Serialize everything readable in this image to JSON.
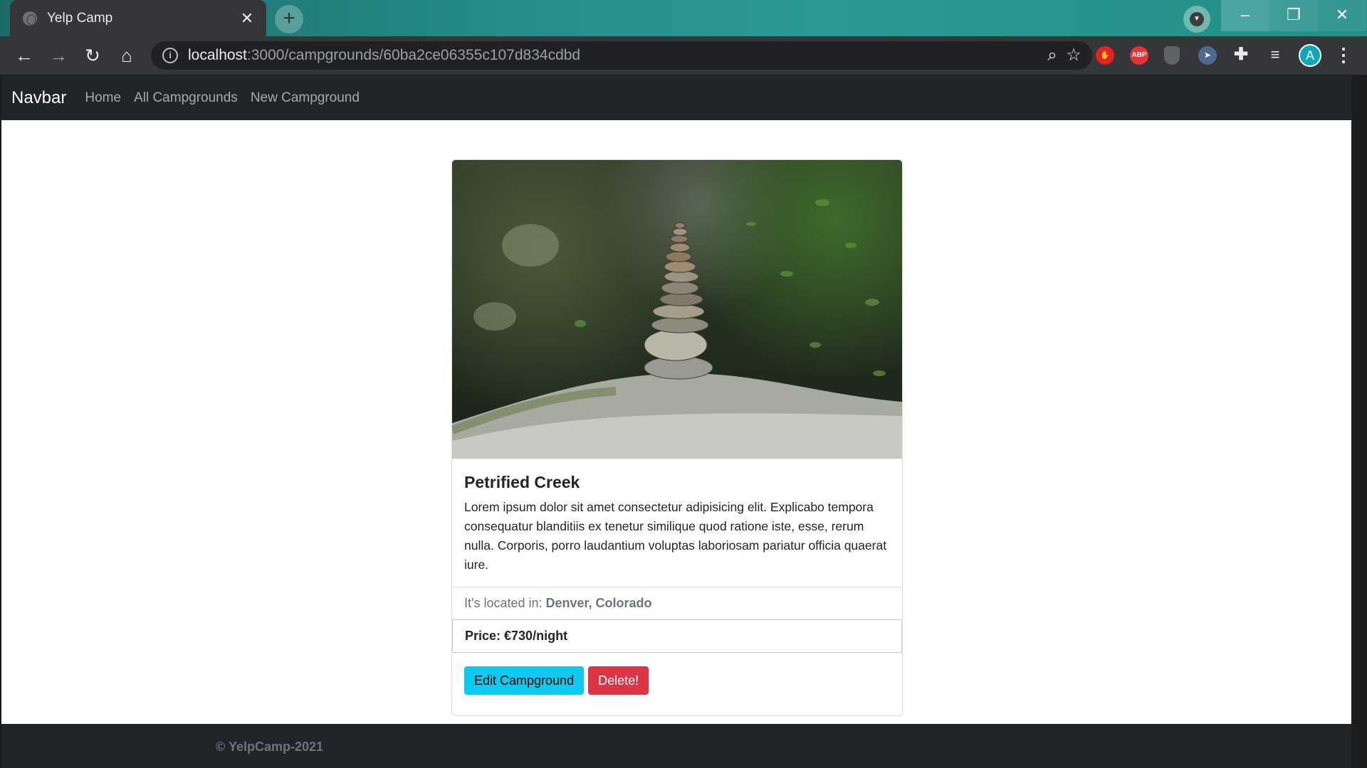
{
  "browser": {
    "tab_title": "Yelp Camp",
    "tab_close": "✕",
    "new_tab": "+",
    "url_host": "localhost",
    "url_path": ":3000/campgrounds/60ba2ce06355c107d834cdbd",
    "extensions": [
      "ABP"
    ],
    "avatar_letter": "A",
    "window_controls": {
      "minimize": "–",
      "maximize": "❐",
      "close": "✕"
    }
  },
  "site_nav": {
    "brand": "Navbar",
    "links": [
      "Home",
      "All Campgrounds",
      "New Campground"
    ]
  },
  "campground": {
    "image_alt": "stacked stones cairn on mossy rock",
    "title": "Petrified Creek",
    "description": "Lorem ipsum dolor sit amet consectetur adipisicing elit. Explicabo tempora consequatur blanditiis ex tenetur similique quod ratione iste, esse, rerum nulla. Corporis, porro laudantium voluptas laboriosam pariatur officia quaerat iure.",
    "location_label": "It's located in:",
    "location": "Denver, Colorado",
    "price": "Price: €730/night",
    "edit_label": "Edit Campground",
    "delete_label": "Delete!"
  },
  "footer": {
    "text": "© YelpCamp-2021"
  },
  "colors": {
    "chrome_teal": "#27908a",
    "nav_dark": "#212529",
    "btn_info": "#0dcaf0",
    "btn_danger": "#dc3545"
  }
}
